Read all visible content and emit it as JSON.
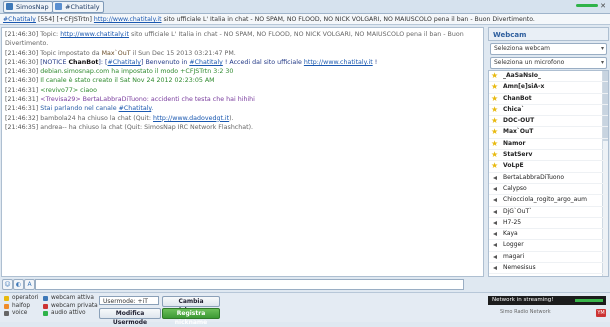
{
  "tabs": [
    {
      "label": "SimosNap"
    },
    {
      "label": "#Chatitaly"
    }
  ],
  "topic": {
    "channel": "#Chatitaly",
    "count": "[554]",
    "flags": "[+CFJSTrtn]",
    "url": "http://www.chatitaly.it",
    "text": " sito ufficiale L' Italia in chat - NO SPAM, NO FLOOD, NO NICK VOLGARI, NO MAIUSCOLO pena il ban - Buon Divertimento."
  },
  "messages": [
    {
      "time": "[21:46:30]",
      "parts": [
        {
          "t": "Topic: ",
          "c": "c-gray"
        },
        {
          "t": "http://www.chatitaly.it",
          "c": "lnk"
        },
        {
          "t": " sito ufficiale L' Italia in chat - NO SPAM, NO FLOOD, NO NICK VOLGARI, NO MAIUSCOLO pena il ban - Buon",
          "c": "c-gray"
        }
      ]
    },
    {
      "time": "",
      "parts": [
        {
          "t": "Divertimento.",
          "c": "c-gray"
        }
      ]
    },
    {
      "time": "[21:46:30]",
      "parts": [
        {
          "t": "Topic impostato da ",
          "c": "c-gray"
        },
        {
          "t": "Max`OuT",
          "c": "c-brown"
        },
        {
          "t": " il Sun Dec 15 2013 03:21:47 PM.",
          "c": "c-gray"
        }
      ]
    },
    {
      "time": "[21:46:30]",
      "parts": [
        {
          "t": "[NOTICE ",
          "c": "c-navy"
        },
        {
          "t": "ChanBot",
          "c": "chanbot"
        },
        {
          "t": "]: [",
          "c": "c-navy"
        },
        {
          "t": "#Chatitaly",
          "c": "lnk"
        },
        {
          "t": "] Benvenuto in ",
          "c": "c-navy"
        },
        {
          "t": "#Chatitaly",
          "c": "lnk"
        },
        {
          "t": " ! Accedi dal sito ufficiale ",
          "c": "c-navy"
        },
        {
          "t": "http://www.chatitaly.it",
          "c": "lnk"
        },
        {
          "t": " !",
          "c": "c-navy"
        }
      ]
    },
    {
      "time": "[21:46:30]",
      "parts": [
        {
          "t": "debian.simosnap.com",
          "c": "c-green"
        },
        {
          "t": " ha impostato il modo +CFJSTrtn 3:2 30",
          "c": "c-green"
        }
      ]
    },
    {
      "time": "[21:46:30]",
      "parts": [
        {
          "t": "Il canale è stato creato il Sat Nov 24 2012 02:23:05 AM",
          "c": "c-green"
        }
      ]
    },
    {
      "time": "[21:46:31]",
      "parts": [
        {
          "t": "<revivo77> ",
          "c": "c-green"
        },
        {
          "t": "ciaoo",
          "c": "c-green"
        }
      ]
    },
    {
      "time": "[21:46:31]",
      "parts": [
        {
          "t": "<Trevisa29> ",
          "c": "c-purple"
        },
        {
          "t": "BertaLabbraDiTuono: accidenti che testa che hai hihihi",
          "c": "c-purple"
        }
      ]
    },
    {
      "time": "[21:46:31]",
      "parts": [
        {
          "t": "Stai parlando nel canale ",
          "c": "c-blue"
        },
        {
          "t": "#Chatitaly",
          "c": "lnk"
        },
        {
          "t": ".",
          "c": "c-blue"
        }
      ]
    },
    {
      "time": "[21:46:32]",
      "parts": [
        {
          "t": "bambola24 ha chiuso la chat (Quit: ",
          "c": "c-gray"
        },
        {
          "t": "http://www.dadovedgt.it",
          "c": "lnk"
        },
        {
          "t": ").",
          "c": "c-gray"
        }
      ]
    },
    {
      "time": "[21:46:35]",
      "parts": [
        {
          "t": "andrea-- ha chiuso la chat (Quit: SimosNap IRC Network Flashchat).",
          "c": "c-gray"
        }
      ]
    }
  ],
  "webcam": {
    "title": "Webcam",
    "select_webcam": "Seleziona webcam",
    "select_mic": "Seleziona un microfono"
  },
  "users": [
    {
      "name": "_AaSaNsIo_",
      "type": "op"
    },
    {
      "name": "Amn[e]siA-x",
      "type": "op"
    },
    {
      "name": "ChanBot",
      "type": "op"
    },
    {
      "name": "Chica`",
      "type": "op"
    },
    {
      "name": "DOC-OUT",
      "type": "op"
    },
    {
      "name": "Max`OuT",
      "type": "op"
    },
    {
      "name": "Namor",
      "type": "op"
    },
    {
      "name": "StatServ",
      "type": "op"
    },
    {
      "name": "VoLpE",
      "type": "op"
    },
    {
      "name": "BertaLabbraDiTuono",
      "type": "voice"
    },
    {
      "name": "Calypso",
      "type": "voice"
    },
    {
      "name": "Chiocciola_rogito_argo_aum",
      "type": "voice"
    },
    {
      "name": "DjG`OuT`",
      "type": "voice"
    },
    {
      "name": "H7-25",
      "type": "voice"
    },
    {
      "name": "Kaya",
      "type": "voice"
    },
    {
      "name": "Logger",
      "type": "voice"
    },
    {
      "name": "magari",
      "type": "voice"
    },
    {
      "name": "Nemesisus",
      "type": "voice"
    }
  ],
  "legend": {
    "operators": "operatori",
    "halfop": "halfop",
    "voice": "voice",
    "webcam_active": "webcam attiva",
    "webcam_private": "webcam privata",
    "audio_active": "audio attivo"
  },
  "controls": {
    "usermode_label": "Usermode:",
    "usermode_value": "+iT",
    "change_nick": "Cambia nickname",
    "modify_usermode": "Modifica Usermode",
    "register_nick": "Registra nickname"
  },
  "stream": {
    "label": "Network in streaming!"
  },
  "footer": {
    "text": "Simo Radio Network",
    "badge": "YM"
  },
  "colors": {
    "accent": "#3d78b8",
    "green_button": "#3c9a35",
    "op_star": "#e8b90d"
  }
}
